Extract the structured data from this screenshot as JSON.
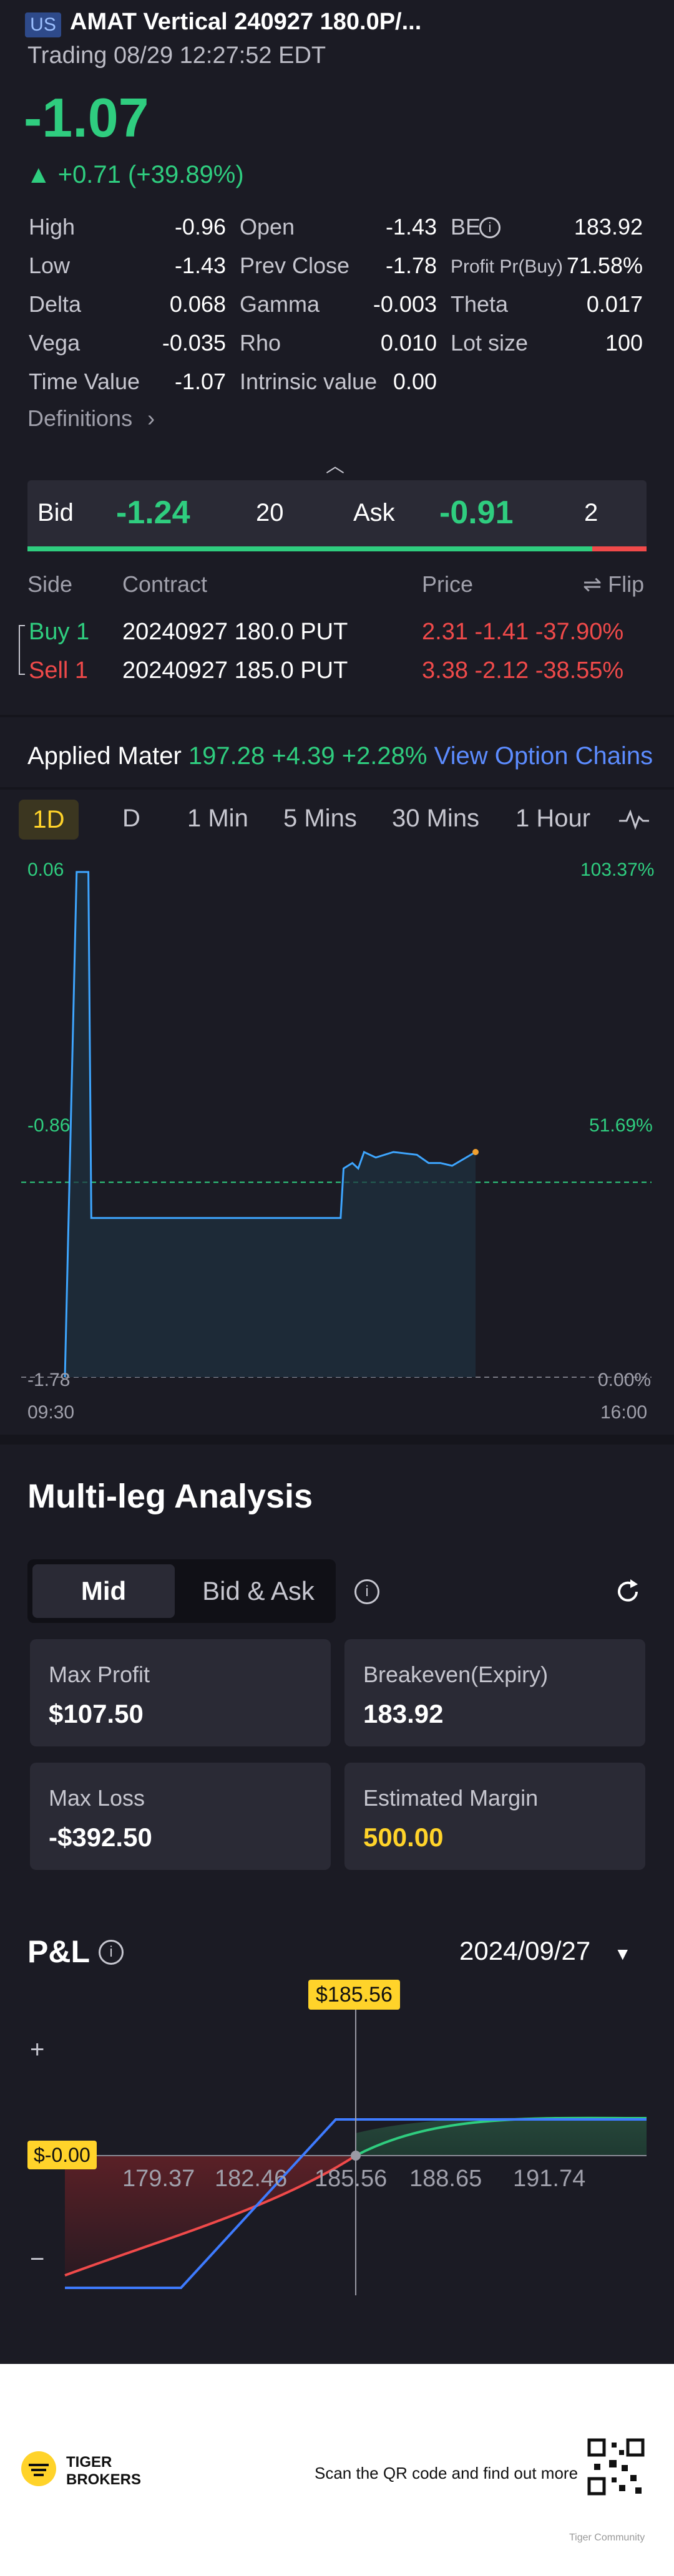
{
  "header": {
    "badge": "US",
    "title": "AMAT Vertical 240927 180.0P/...",
    "subtitle": "Trading 08/29 12:27:52 EDT",
    "price": "-1.07",
    "change": "▲ +0.71 (+39.89%)"
  },
  "stats": {
    "high_label": "High",
    "high": "-0.96",
    "open_label": "Open",
    "open": "-1.43",
    "be_label": "BE",
    "be": "183.92",
    "low_label": "Low",
    "low": "-1.43",
    "prev_close_label": "Prev Close",
    "prev_close": "-1.78",
    "profit_label": "Profit Pr(Buy)",
    "profit": "71.58%",
    "delta_label": "Delta",
    "delta": "0.068",
    "gamma_label": "Gamma",
    "gamma": "-0.003",
    "theta_label": "Theta",
    "theta": "0.017",
    "vega_label": "Vega",
    "vega": "-0.035",
    "rho_label": "Rho",
    "rho": "0.010",
    "lot_label": "Lot size",
    "lot": "100",
    "time_value_label": "Time Value",
    "time_value": "-1.07",
    "intrinsic_label": "Intrinsic value",
    "intrinsic": "0.00"
  },
  "definitions_label": "Definitions",
  "bidask": {
    "bid_label": "Bid",
    "bid": "-1.24",
    "bid_size": "20",
    "ask_label": "Ask",
    "ask": "-0.91",
    "ask_size": "2"
  },
  "legs": {
    "headers": {
      "side": "Side",
      "contract": "Contract",
      "price": "Price",
      "flip": "⇌ Flip"
    },
    "rows": [
      {
        "side": "Buy 1",
        "contract": "20240927 180.0 PUT",
        "price": "2.31 -1.41 -37.90%"
      },
      {
        "side": "Sell 1",
        "contract": "20240927 185.0 PUT",
        "price": "3.38 -2.12 -38.55%"
      }
    ]
  },
  "underlying": {
    "name": "Applied Mater",
    "quote": "197.28 +4.39 +2.28%",
    "link": "View Option Chains"
  },
  "chart_tabs": [
    "1D",
    "D",
    "1 Min",
    "5 Mins",
    "30 Mins",
    "1 Hour"
  ],
  "chart_data": {
    "type": "line",
    "y_left_ticks": [
      "0.06",
      "-0.86",
      "-1.78"
    ],
    "y_right_ticks": [
      "103.37%",
      "51.69%",
      "0.00%"
    ],
    "x_ticks": [
      "09:30",
      "16:00"
    ],
    "ylim": [
      -1.78,
      0.06
    ],
    "reference_line": -1.07,
    "series": [
      {
        "points": [
          [
            0,
            -1.78
          ],
          [
            0.02,
            0.06
          ],
          [
            0.04,
            0.06
          ],
          [
            0.045,
            -1.2
          ],
          [
            0.47,
            -1.2
          ],
          [
            0.475,
            -1.02
          ],
          [
            0.49,
            -1.0
          ],
          [
            0.5,
            -1.02
          ],
          [
            0.51,
            -0.96
          ],
          [
            0.53,
            -0.98
          ],
          [
            0.56,
            -0.96
          ],
          [
            0.6,
            -0.97
          ],
          [
            0.62,
            -1.0
          ],
          [
            0.64,
            -1.0
          ],
          [
            0.66,
            -1.01
          ],
          [
            0.7,
            -0.96
          ]
        ]
      }
    ],
    "colors": {
      "line": "#3ea6ff",
      "ref": "#2fcd7f"
    }
  },
  "multileg": {
    "title": "Multi-leg Analysis",
    "mode_on": "Mid",
    "mode_off": "Bid & Ask",
    "cards": [
      {
        "label": "Max Profit",
        "value": "$107.50"
      },
      {
        "label": "Breakeven(Expiry)",
        "value": "183.92"
      },
      {
        "label": "Max Loss",
        "value": "-$392.50"
      },
      {
        "label": "Estimated Margin",
        "value": "500.00"
      }
    ]
  },
  "pnl": {
    "title": "P&L",
    "date": "2024/09/27",
    "marker": "$185.56",
    "zero_label": "$-0.00",
    "plus": "+",
    "minus": "−",
    "x_ticks": [
      "179.37",
      "182.46",
      "185.56",
      "188.65",
      "191.74"
    ]
  },
  "footer": {
    "brand_top": "TIGER",
    "brand_bottom": "BROKERS",
    "cta": "Scan the QR code and find out more",
    "tiny": "Tiger Community"
  }
}
